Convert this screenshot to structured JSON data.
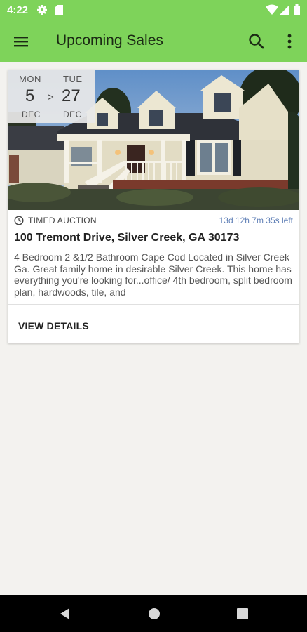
{
  "status_bar": {
    "time": "4:22",
    "icons": [
      "settings-icon",
      "sd-card-icon",
      "wifi-icon",
      "signal-icon",
      "battery-icon"
    ]
  },
  "app_bar": {
    "title": "Upcoming Sales",
    "icons": [
      "menu-icon",
      "search-icon",
      "more-vert-icon"
    ],
    "color": "#7ed35a"
  },
  "sale": {
    "start": {
      "dow": "MON",
      "day": "5",
      "month": "DEC"
    },
    "separator": ">",
    "end": {
      "dow": "TUE",
      "day": "27",
      "month": "DEC"
    },
    "type": "TIMED AUCTION",
    "time_left": "13d 12h 7m 35s left",
    "address": "100 Tremont Drive, Silver Creek, GA 30173",
    "description": "4 Bedroom 2 &1/2 Bathroom Cape Cod Located in Silver Creek Ga. Great family home in desirable Silver Creek. This home has everything you're looking for...office/ 4th bedroom, split bedroom plan, hardwoods, tile, and",
    "details_label": "VIEW DETAILS"
  },
  "nav_bar": {
    "icons": [
      "back-icon",
      "home-icon",
      "recents-icon"
    ]
  }
}
